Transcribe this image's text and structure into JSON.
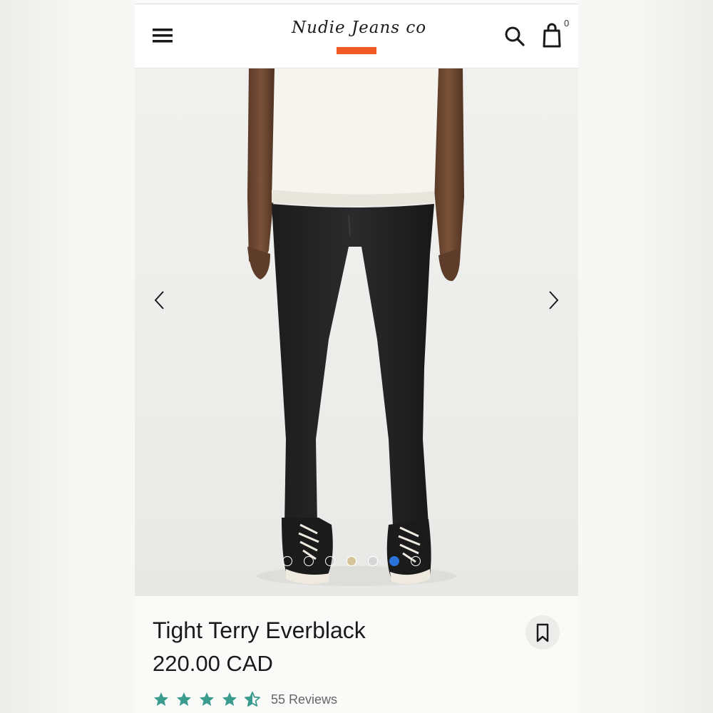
{
  "header": {
    "logo_text": "Nudie Jeans co",
    "cart_count": "0"
  },
  "gallery": {
    "image_count": 7,
    "active_index": 5,
    "colors": {
      "active_dot": "#2a73d8",
      "gold_dot": "#d6c49a",
      "logo_accent": "#f15a22"
    }
  },
  "product": {
    "name": "Tight Terry Everblack",
    "price": "220.00 CAD",
    "rating": 4.5,
    "reviews": "55 Reviews",
    "star_color": "#3a9c8f"
  },
  "icons": [
    "hamburger-menu-icon",
    "search-icon",
    "shopping-bag-icon",
    "chevron-left-icon",
    "chevron-right-icon",
    "bookmark-icon",
    "star-icon"
  ]
}
